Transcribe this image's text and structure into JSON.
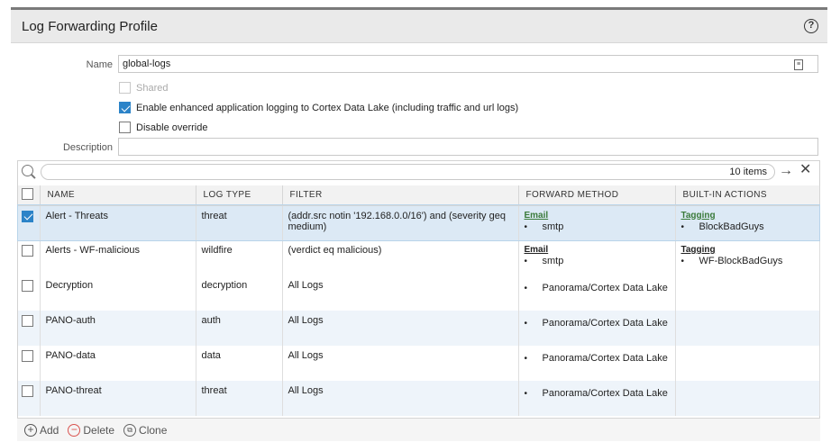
{
  "dialog": {
    "title": "Log Forwarding Profile",
    "help_icon": "help-circle-icon"
  },
  "form": {
    "name_label": "Name",
    "name_value": "global-logs",
    "shared_label": "Shared",
    "enhanced_logging_label": "Enable enhanced application logging to Cortex Data Lake (including traffic and url logs)",
    "disable_override_label": "Disable override",
    "description_label": "Description",
    "description_value": ""
  },
  "grid": {
    "items_count": "10 items",
    "columns": [
      "NAME",
      "LOG TYPE",
      "FILTER",
      "FORWARD METHOD",
      "BUILT-IN ACTIONS"
    ],
    "rows": [
      {
        "name": "Alert - Threats",
        "log_type": "threat",
        "filter": "(addr.src notin '192.168.0.0/16') and (severity geq medium)",
        "fm_title": "Email",
        "fm_item": "smtp",
        "action_title": "Tagging",
        "action_item": "BlockBadGuys",
        "selected": true
      },
      {
        "name": "Alerts - WF-malicious",
        "log_type": "wildfire",
        "filter": "(verdict eq malicious)",
        "fm_title": "Email",
        "fm_item": "smtp",
        "action_title": "Tagging",
        "action_item": "WF-BlockBadGuys"
      },
      {
        "name": "Decryption",
        "log_type": "decryption",
        "filter": "All Logs",
        "fm_item": "Panorama/Cortex Data Lake"
      },
      {
        "name": "PANO-auth",
        "log_type": "auth",
        "filter": "All Logs",
        "fm_item": "Panorama/Cortex Data Lake"
      },
      {
        "name": "PANO-data",
        "log_type": "data",
        "filter": "All Logs",
        "fm_item": "Panorama/Cortex Data Lake"
      },
      {
        "name": "PANO-threat",
        "log_type": "threat",
        "filter": "All Logs",
        "fm_item": "Panorama/Cortex Data Lake"
      }
    ]
  },
  "footer": {
    "add_label": "Add",
    "delete_label": "Delete",
    "clone_label": "Clone"
  },
  "colors": {
    "accent": "#2b83c8",
    "delete": "#d9534f"
  }
}
